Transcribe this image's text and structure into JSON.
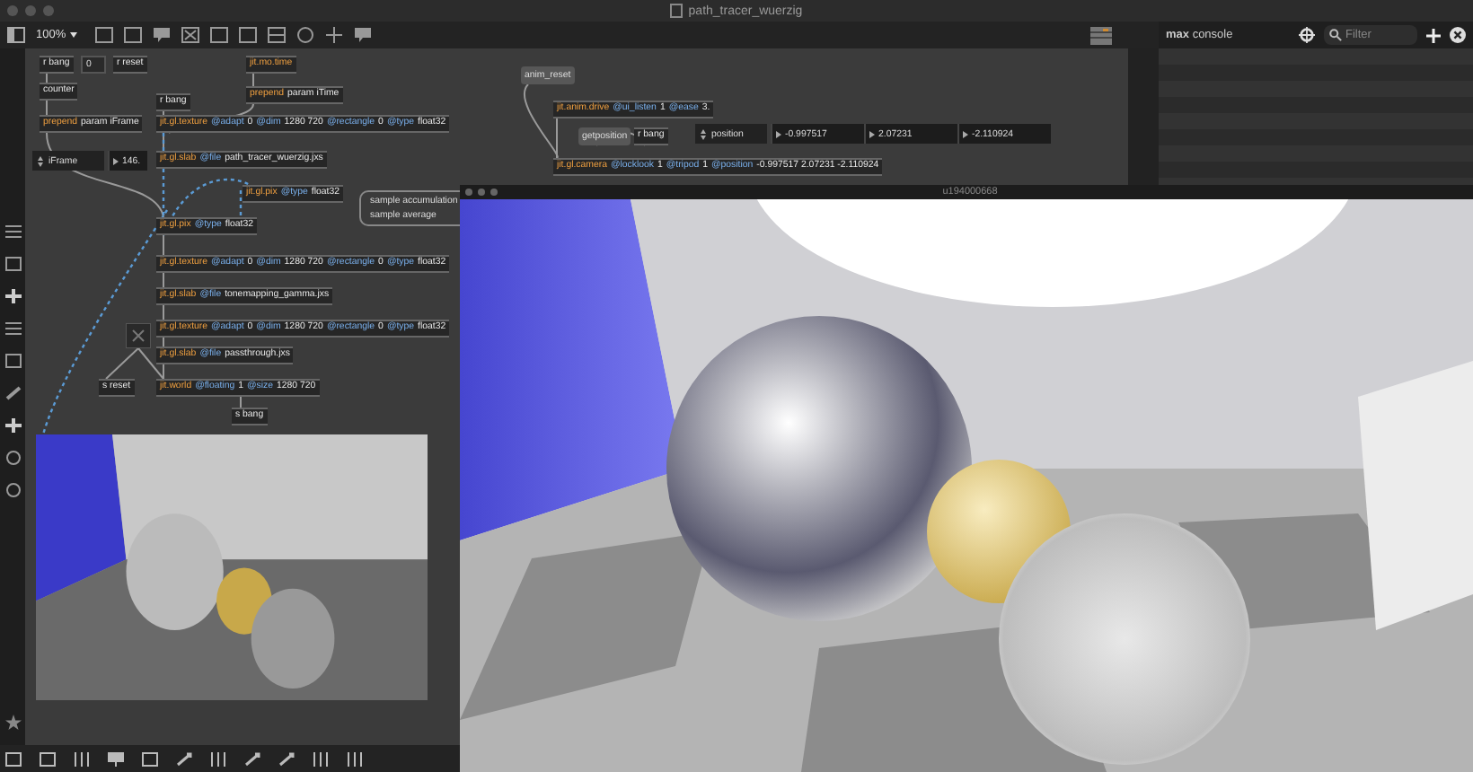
{
  "window": {
    "title": "path_tracer_wuerzig"
  },
  "toolbar": {
    "zoom": "100%"
  },
  "patch": {
    "boxes": [
      {
        "kind": "object",
        "tokens": [
          {
            "text": "r bang",
            "kind": "arg"
          }
        ]
      },
      {
        "kind": "number",
        "value": "0"
      },
      {
        "kind": "object",
        "tokens": [
          {
            "text": "r reset",
            "kind": "arg"
          }
        ]
      },
      {
        "kind": "object",
        "tokens": [
          {
            "text": "jit.mo.time",
            "kind": "class"
          }
        ]
      },
      {
        "kind": "object",
        "tokens": [
          {
            "text": "counter",
            "kind": "arg"
          }
        ]
      },
      {
        "kind": "object",
        "tokens": [
          {
            "text": "prepend",
            "kind": "class"
          },
          {
            "text": "param iTime",
            "kind": "arg"
          }
        ]
      },
      {
        "kind": "object",
        "tokens": [
          {
            "text": "r bang",
            "kind": "arg"
          }
        ]
      },
      {
        "kind": "object",
        "tokens": [
          {
            "text": "prepend",
            "kind": "class"
          },
          {
            "text": "param iFrame",
            "kind": "arg"
          }
        ]
      },
      {
        "kind": "object",
        "tokens": [
          {
            "text": "jit.gl.texture",
            "kind": "class"
          },
          {
            "text": "@adapt",
            "kind": "attr"
          },
          {
            "text": "0",
            "kind": "arg"
          },
          {
            "text": "@dim",
            "kind": "attr"
          },
          {
            "text": "1280 720",
            "kind": "arg"
          },
          {
            "text": "@rectangle",
            "kind": "attr"
          },
          {
            "text": "0",
            "kind": "arg"
          },
          {
            "text": "@type",
            "kind": "attr"
          },
          {
            "text": "float32",
            "kind": "arg"
          }
        ]
      },
      {
        "kind": "attrui",
        "label": "iFrame",
        "values": [
          "146."
        ]
      },
      {
        "kind": "object",
        "tokens": [
          {
            "text": "jit.gl.slab",
            "kind": "class"
          },
          {
            "text": "@file",
            "kind": "attr"
          },
          {
            "text": "path_tracer_wuerzig.jxs",
            "kind": "arg"
          }
        ]
      },
      {
        "kind": "object",
        "tokens": [
          {
            "text": "jit.gl.pix",
            "kind": "class"
          },
          {
            "text": "@type",
            "kind": "attr"
          },
          {
            "text": "float32",
            "kind": "arg"
          }
        ]
      },
      {
        "kind": "comment",
        "lines": [
          "sample accumulation",
          "sample average"
        ]
      },
      {
        "kind": "object",
        "tokens": [
          {
            "text": "jit.gl.pix",
            "kind": "class"
          },
          {
            "text": "@type",
            "kind": "attr"
          },
          {
            "text": "float32",
            "kind": "arg"
          }
        ]
      },
      {
        "kind": "object",
        "tokens": [
          {
            "text": "jit.gl.texture",
            "kind": "class"
          },
          {
            "text": "@adapt",
            "kind": "attr"
          },
          {
            "text": "0",
            "kind": "arg"
          },
          {
            "text": "@dim",
            "kind": "attr"
          },
          {
            "text": "1280 720",
            "kind": "arg"
          },
          {
            "text": "@rectangle",
            "kind": "attr"
          },
          {
            "text": "0",
            "kind": "arg"
          },
          {
            "text": "@type",
            "kind": "attr"
          },
          {
            "text": "float32",
            "kind": "arg"
          }
        ]
      },
      {
        "kind": "object",
        "tokens": [
          {
            "text": "jit.gl.slab",
            "kind": "class"
          },
          {
            "text": "@file",
            "kind": "attr"
          },
          {
            "text": "tonemapping_gamma.jxs",
            "kind": "arg"
          }
        ]
      },
      {
        "kind": "object",
        "tokens": [
          {
            "text": "jit.gl.texture",
            "kind": "class"
          },
          {
            "text": "@adapt",
            "kind": "attr"
          },
          {
            "text": "0",
            "kind": "arg"
          },
          {
            "text": "@dim",
            "kind": "attr"
          },
          {
            "text": "1280 720",
            "kind": "arg"
          },
          {
            "text": "@rectangle",
            "kind": "attr"
          },
          {
            "text": "0",
            "kind": "arg"
          },
          {
            "text": "@type",
            "kind": "attr"
          },
          {
            "text": "float32",
            "kind": "arg"
          }
        ]
      },
      {
        "kind": "button"
      },
      {
        "kind": "object",
        "tokens": [
          {
            "text": "jit.gl.slab",
            "kind": "class"
          },
          {
            "text": "@file",
            "kind": "attr"
          },
          {
            "text": "passthrough.jxs",
            "kind": "arg"
          }
        ]
      },
      {
        "kind": "object",
        "tokens": [
          {
            "text": "s reset",
            "kind": "arg"
          }
        ]
      },
      {
        "kind": "object",
        "tokens": [
          {
            "text": "jit.world",
            "kind": "class"
          },
          {
            "text": "@floating",
            "kind": "attr"
          },
          {
            "text": "1",
            "kind": "arg"
          },
          {
            "text": "@size",
            "kind": "attr"
          },
          {
            "text": "1280 720",
            "kind": "arg"
          }
        ]
      },
      {
        "kind": "object",
        "tokens": [
          {
            "text": "s bang",
            "kind": "arg"
          }
        ]
      },
      {
        "kind": "message",
        "text": "anim_reset"
      },
      {
        "kind": "object",
        "tokens": [
          {
            "text": "jit.anim.drive",
            "kind": "class"
          },
          {
            "text": "@ui_listen",
            "kind": "attr"
          },
          {
            "text": "1",
            "kind": "arg"
          },
          {
            "text": "@ease",
            "kind": "attr"
          },
          {
            "text": "3.",
            "kind": "arg"
          }
        ]
      },
      {
        "kind": "message",
        "text": "getposition"
      },
      {
        "kind": "object",
        "tokens": [
          {
            "text": "r bang",
            "kind": "arg"
          }
        ]
      },
      {
        "kind": "attrui",
        "label": "position",
        "values": [
          "-0.997517",
          "2.07231",
          "-2.110924"
        ]
      },
      {
        "kind": "object",
        "tokens": [
          {
            "text": "jit.gl.camera",
            "kind": "class"
          },
          {
            "text": "@locklook",
            "kind": "attr"
          },
          {
            "text": "1",
            "kind": "arg"
          },
          {
            "text": "@tripod",
            "kind": "attr"
          },
          {
            "text": "1",
            "kind": "arg"
          },
          {
            "text": "@position",
            "kind": "attr"
          },
          {
            "text": "-0.997517 2.07231 -2.110924",
            "kind": "arg"
          }
        ]
      }
    ]
  },
  "render_window": {
    "title": "u194000668"
  },
  "console": {
    "title": "**max** console",
    "filter": {
      "placeholder": "Filter"
    }
  }
}
